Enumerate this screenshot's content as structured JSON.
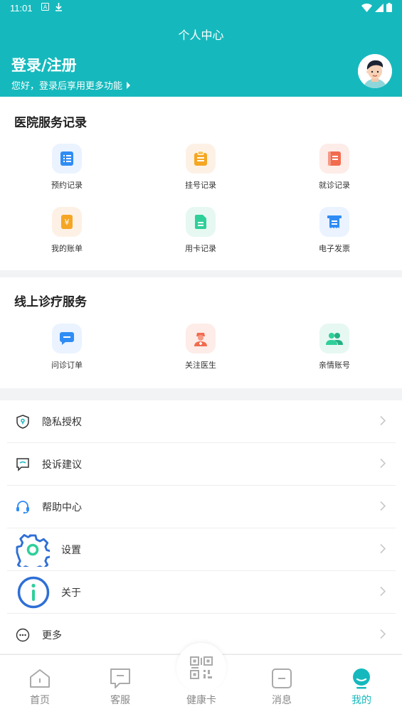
{
  "status_bar": {
    "time": "11:01"
  },
  "header": {
    "title": "个人中心",
    "login_title": "登录/注册",
    "login_subtitle": "您好，登录后享用更多功能"
  },
  "hospital_records": {
    "title": "医院服务记录",
    "items": [
      {
        "label": "预约记录",
        "icon": "appointment-record-icon"
      },
      {
        "label": "挂号记录",
        "icon": "registration-record-icon"
      },
      {
        "label": "就诊记录",
        "icon": "visit-record-icon"
      },
      {
        "label": "我的账单",
        "icon": "bill-icon"
      },
      {
        "label": "用卡记录",
        "icon": "card-usage-icon"
      },
      {
        "label": "电子发票",
        "icon": "e-invoice-icon"
      }
    ]
  },
  "online_services": {
    "title": "线上诊疗服务",
    "items": [
      {
        "label": "问诊订单",
        "icon": "consultation-order-icon"
      },
      {
        "label": "关注医生",
        "icon": "followed-doctor-icon"
      },
      {
        "label": "亲情账号",
        "icon": "family-account-icon"
      }
    ]
  },
  "menu": [
    {
      "label": "隐私授权",
      "icon": "privacy-shield-icon"
    },
    {
      "label": "投诉建议",
      "icon": "feedback-icon"
    },
    {
      "label": "帮助中心",
      "icon": "headset-icon"
    },
    {
      "label": "设置",
      "icon": "gear-icon"
    },
    {
      "label": "关于",
      "icon": "info-icon"
    },
    {
      "label": "更多",
      "icon": "more-icon"
    }
  ],
  "bottom_nav": {
    "items": [
      {
        "label": "首页",
        "icon": "home-icon"
      },
      {
        "label": "客服",
        "icon": "customer-service-icon"
      },
      {
        "label": "健康卡",
        "icon": "qr-code-icon"
      },
      {
        "label": "消息",
        "icon": "message-icon"
      },
      {
        "label": "我的",
        "icon": "profile-icon"
      }
    ],
    "active": "我的"
  },
  "colors": {
    "brand": "#15b9bd",
    "page_bg": "#f2f3f5",
    "blue": "#2f8cf5",
    "orange": "#f5a623",
    "red": "#f26b4f",
    "green": "#2fcf9a"
  }
}
